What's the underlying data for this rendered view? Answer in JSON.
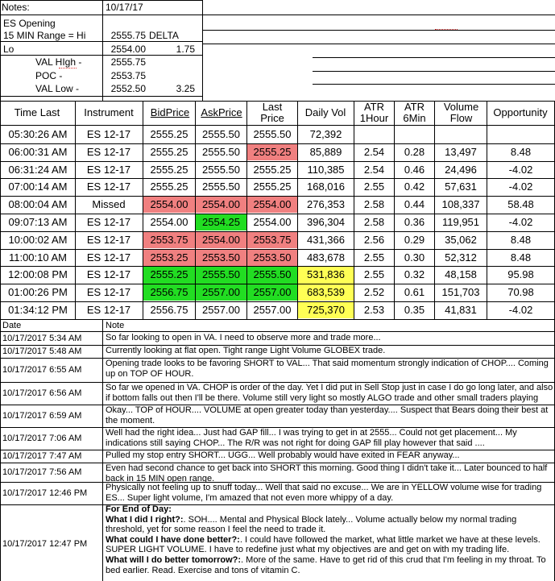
{
  "header": {
    "notes_label": "Notes:",
    "date": "10/17/17",
    "rows": [
      {
        "label": "ES Opening",
        "value": "",
        "extra": ""
      },
      {
        "label": "15 MIN Range = Hi",
        "value": "2555.75",
        "extra": "DELTA"
      },
      {
        "label": "Lo",
        "value": "2554.00",
        "extra": "1.75"
      },
      {
        "label": "VAL HIgh  -",
        "value": "2555.75",
        "extra": ""
      },
      {
        "label": "POC  -",
        "value": "2553.75",
        "extra": ""
      },
      {
        "label": "VAL Low  -",
        "value": "2552.50",
        "extra": "3.25"
      }
    ]
  },
  "table": {
    "columns": [
      "Time Last",
      "Instrument",
      "BidPrice",
      "AskPrice",
      "Last Price",
      "Daily Vol",
      "ATR 1Hour",
      "ATR 6Min",
      "Volume Flow",
      "Opportunity"
    ],
    "rows": [
      {
        "time": "05:30:26 AM",
        "inst": "ES 12-17",
        "bid": "2555.25",
        "ask": "2555.50",
        "last": "2555.50",
        "vol": "72,392",
        "atr1": "",
        "atr6": "",
        "flow": "",
        "opp": ""
      },
      {
        "time": "06:00:31 AM",
        "inst": "ES 12-17",
        "bid": "2555.25",
        "ask": "2555.50",
        "last": "2555.25",
        "vol": "85,889",
        "atr1": "2.54",
        "atr6": "0.28",
        "flow": "13,497",
        "opp": "8.48"
      },
      {
        "time": "06:31:24 AM",
        "inst": "ES 12-17",
        "bid": "2555.25",
        "ask": "2555.50",
        "last": "2555.25",
        "vol": "110,385",
        "atr1": "2.54",
        "atr6": "0.46",
        "flow": "24,496",
        "opp": "-4.02"
      },
      {
        "time": "07:00:14 AM",
        "inst": "ES 12-17",
        "bid": "2555.25",
        "ask": "2555.50",
        "last": "2555.25",
        "vol": "168,016",
        "atr1": "2.55",
        "atr6": "0.42",
        "flow": "57,631",
        "opp": "-4.02"
      },
      {
        "time": "08:00:04 AM",
        "inst": "Missed",
        "bid": "2554.00",
        "ask": "2554.00",
        "last": "2554.00",
        "vol": "276,353",
        "atr1": "2.58",
        "atr6": "0.44",
        "flow": "108,337",
        "opp": "58.48"
      },
      {
        "time": "09:07:13 AM",
        "inst": "ES 12-17",
        "bid": "2554.00",
        "ask": "2554.25",
        "last": "2554.00",
        "vol": "396,304",
        "atr1": "2.58",
        "atr6": "0.36",
        "flow": "119,951",
        "opp": "-4.02"
      },
      {
        "time": "10:00:02 AM",
        "inst": "ES 12-17",
        "bid": "2553.75",
        "ask": "2554.00",
        "last": "2553.75",
        "vol": "431,366",
        "atr1": "2.56",
        "atr6": "0.29",
        "flow": "35,062",
        "opp": "8.48"
      },
      {
        "time": "11:00:10 AM",
        "inst": "ES 12-17",
        "bid": "2553.25",
        "ask": "2553.50",
        "last": "2553.50",
        "vol": "483,678",
        "atr1": "2.55",
        "atr6": "0.30",
        "flow": "52,312",
        "opp": "8.48"
      },
      {
        "time": "12:00:08 PM",
        "inst": "ES 12-17",
        "bid": "2555.25",
        "ask": "2555.50",
        "last": "2555.50",
        "vol": "531,836",
        "atr1": "2.55",
        "atr6": "0.32",
        "flow": "48,158",
        "opp": "95.98"
      },
      {
        "time": "01:00:26 PM",
        "inst": "ES 12-17",
        "bid": "2556.75",
        "ask": "2557.00",
        "last": "2557.00",
        "vol": "683,539",
        "atr1": "2.52",
        "atr6": "0.61",
        "flow": "151,703",
        "opp": "70.98"
      },
      {
        "time": "01:34:12 PM",
        "inst": "ES 12-17",
        "bid": "2556.75",
        "ask": "2557.00",
        "last": "2557.00",
        "vol": "725,370",
        "atr1": "2.53",
        "atr6": "0.35",
        "flow": "41,831",
        "opp": "-4.02"
      }
    ]
  },
  "notes": {
    "date_header": "Date",
    "note_header": "Note",
    "rows": [
      {
        "date": "10/17/2017 5:34 AM",
        "text": "So far looking to open in VA.  I need to observe more and trade more..."
      },
      {
        "date": "10/17/2017 5:48 AM",
        "text": "Currently looking at flat open.  Tight range Light Volume GLOBEX trade."
      },
      {
        "date": "10/17/2017 6:55 AM",
        "text": "Opening trade looks to be favoring SHORT to VAL... That said momentum strongly indication of CHOP.... Coming up on TOP OF HOUR."
      },
      {
        "date": "10/17/2017 6:56 AM",
        "text": "So far we opened in VA.  CHOP is order of the day.  Yet I did put in Sell Stop just in case I do go long later, and also if bottom falls out then I'll be there.  Volume still very light so mostly ALGO trade and other small traders playing IMHO"
      },
      {
        "date": "10/17/2017 6:59 AM",
        "text": "Okay... TOP of HOUR.... VOLUME at open greater today than yesterday.... Suspect that Bears doing their best at the moment."
      },
      {
        "date": "10/17/2017 7:06 AM",
        "text": "Well had the right idea... Just had GAP fill... I was trying to get in at 2555... Could not get placement... My indications still saying CHOP... The R/R was not right for doing GAP fill play however that said ...."
      },
      {
        "date": "10/17/2017 7:47 AM",
        "text": "Pulled my stop entry SHORT... UGG... Well probably would have exited in FEAR anyway..."
      },
      {
        "date": "10/17/2017 7:56 AM",
        "text": "Even had second chance to get back into SHORT this morning.  Good thing I didn't take it... Later bounced to half back in 15 MIN open range."
      },
      {
        "date": "10/17/2017 12:46 PM",
        "text": "Physically not feeling up to snuff today... Well that said no excuse... We are in YELLOW volume wise for trading ES... Super light volume, I'm amazed that not even more whippy of a day."
      }
    ],
    "last": {
      "date": "10/17/2017 12:47 PM",
      "title": "For End of Day:",
      "q1": "What I did I right?:",
      "a1": ".  SOH.... Mental and Physical Block lately...   Volume actually below my normal trading threshold, yet for some reason I feel the need to trade it.",
      "q2": "What could I have done better?:",
      "a2": ".  I could have followed the market, what little market we have at these levels. SUPER LIGHT VOLUME.  I have to redefine just what my objectives are and get on with my trading life.",
      "q3": "What will I do better tomorrow?:",
      "a3": ".  More of the same.  Have to get rid of this crud that I'm feeling in my throat.  To bed earlier.  Read.  Exercise and tons of vitamin C."
    }
  },
  "colors": {
    "red": "#f08080",
    "green": "#22dd22",
    "yellow": "#ffff55"
  }
}
